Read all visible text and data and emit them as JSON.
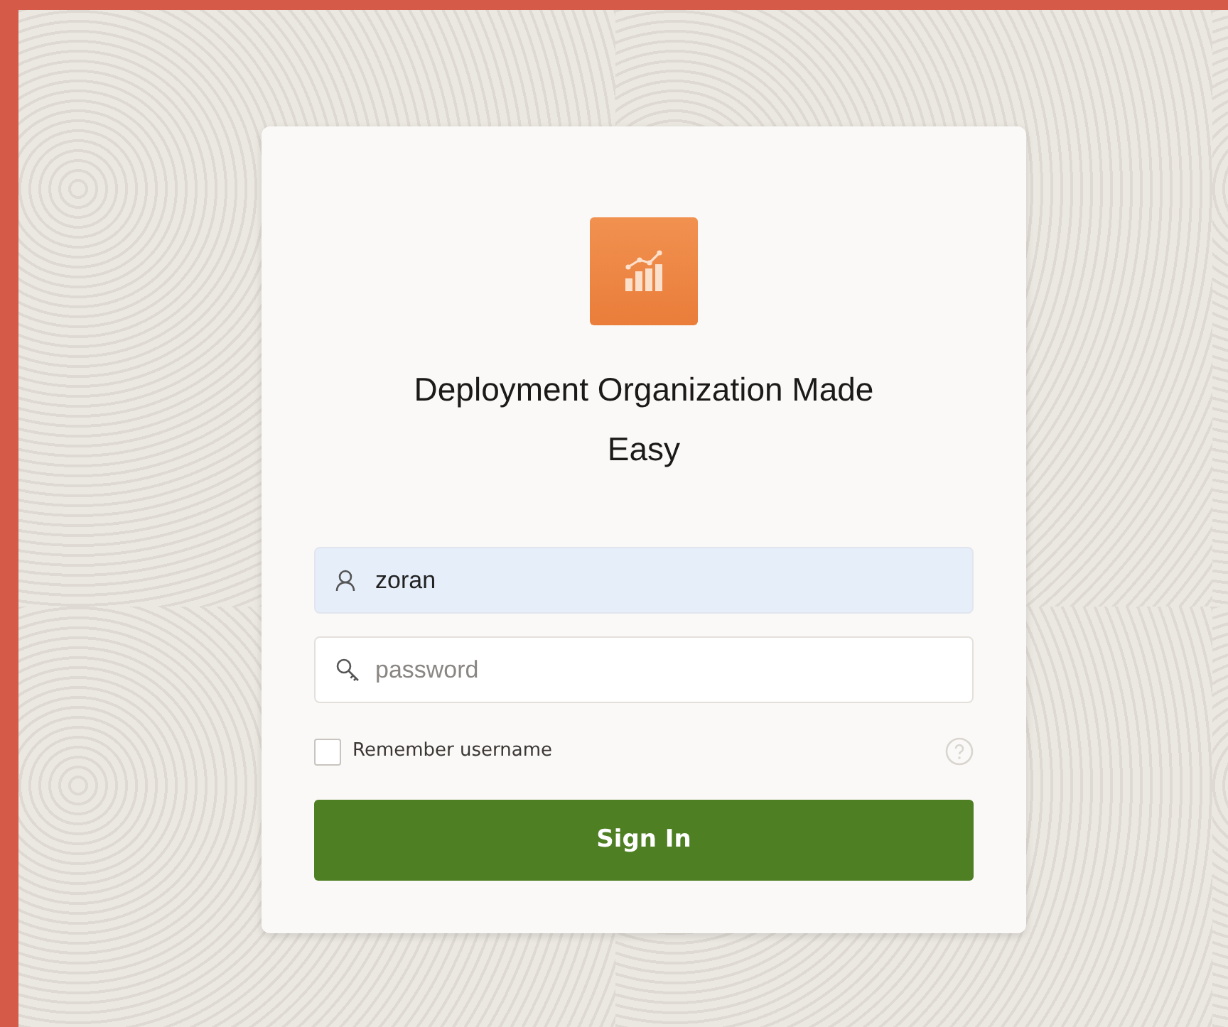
{
  "app": {
    "title": "Deployment Organization Made Easy"
  },
  "username": {
    "value": "zoran",
    "autofilled": true
  },
  "password": {
    "placeholder": "password"
  },
  "remember": {
    "label": "Remember username",
    "checked": false
  },
  "sign_in": {
    "label": "Sign In"
  }
}
